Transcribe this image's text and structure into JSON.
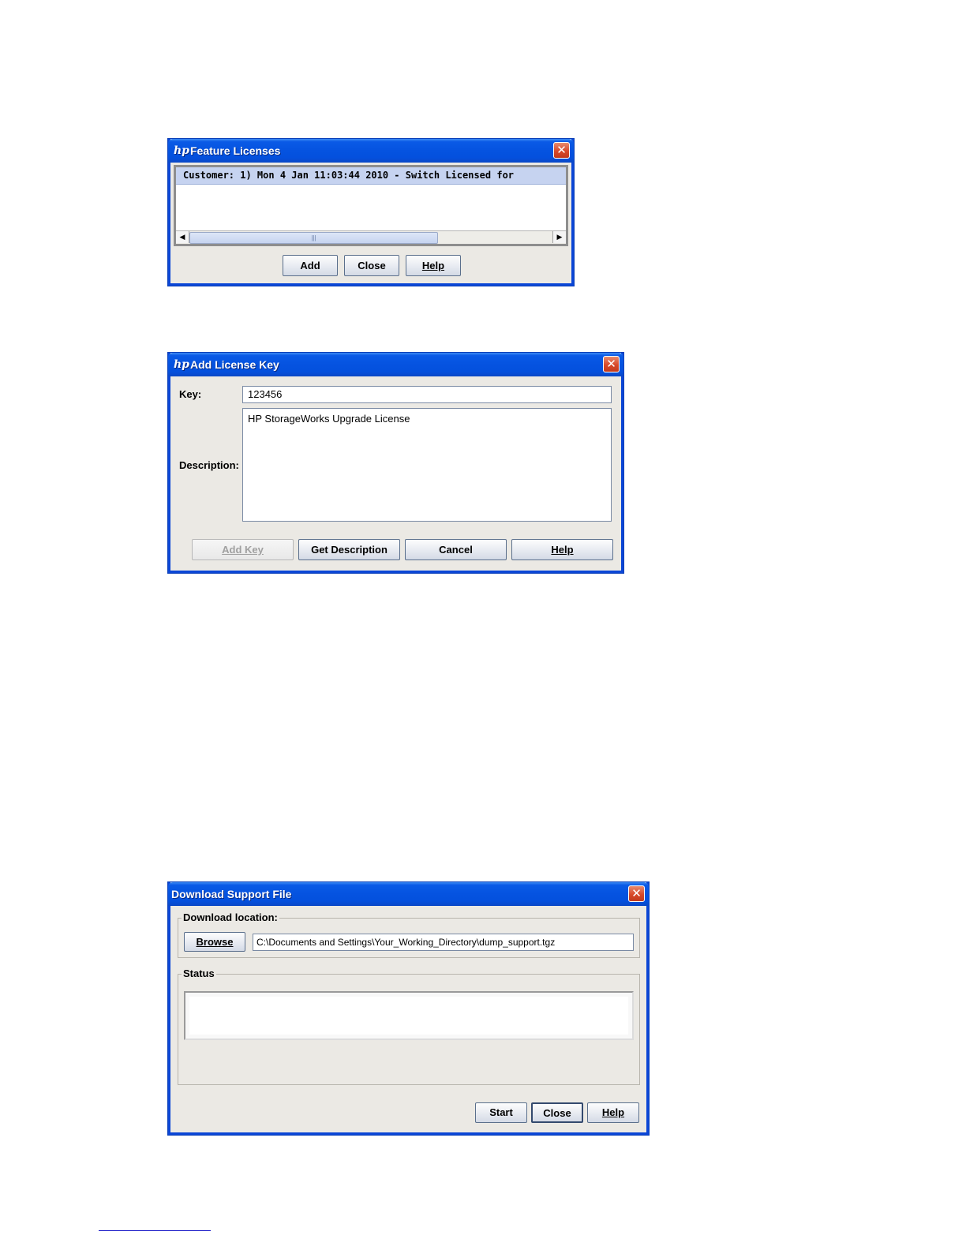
{
  "feature_licenses": {
    "title": "Feature Licenses",
    "list_row": "Customer: 1) Mon 4 Jan 11:03:44 2010 - Switch Licensed for",
    "buttons": {
      "add": "Add",
      "close": "Close",
      "help": "Help"
    }
  },
  "add_license_key": {
    "title": "Add License Key",
    "key_label": "Key:",
    "key_value": "123456",
    "description_label": "Description:",
    "description_value": "HP StorageWorks Upgrade License",
    "buttons": {
      "add_key": "Add Key",
      "get_description": "Get Description",
      "cancel": "Cancel",
      "help": "Help"
    }
  },
  "download_support": {
    "title": "Download Support File",
    "location_group": "Download location:",
    "browse": "Browse",
    "path_value": "C:\\Documents and Settings\\Your_Working_Directory\\dump_support.tgz",
    "status_group": "Status",
    "buttons": {
      "start": "Start",
      "close": "Close",
      "help": "Help"
    }
  },
  "colors": {
    "titlebar": "#0553e0",
    "dialog_bg": "#ebe9e4",
    "close_button": "#d8492a"
  }
}
